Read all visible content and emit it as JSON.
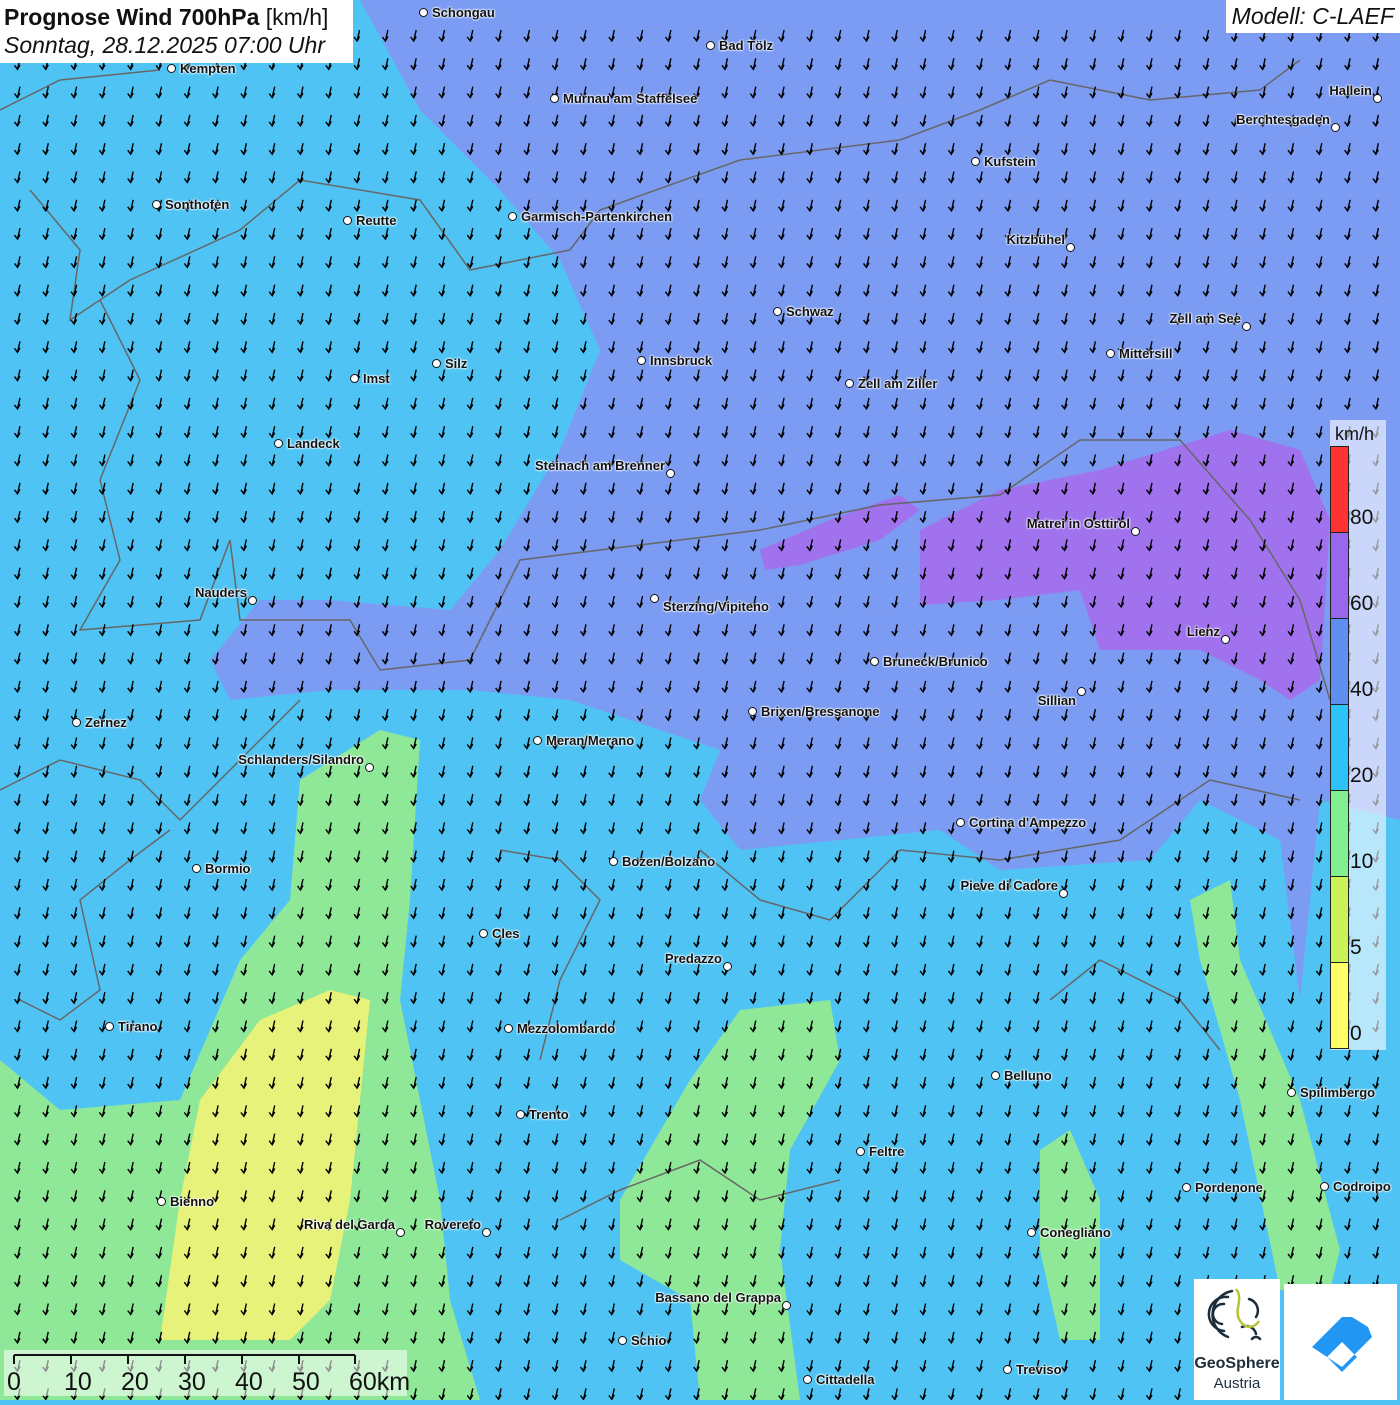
{
  "header": {
    "title": "Prognose Wind 700hPa",
    "unit": "[km/h]",
    "datetime": "Sonntag, 28.12.2025 07:00 Uhr",
    "model": "Modell: C-LAEF"
  },
  "legend": {
    "unit": "km/h",
    "labels": [
      "80",
      "60",
      "40",
      "20",
      "10",
      "5",
      "0"
    ],
    "colors": [
      "#ff3333",
      "#9966ee",
      "#5f8ff0",
      "#2cc4f8",
      "#80f090",
      "#ccf25a",
      "#ffff66"
    ]
  },
  "scale": {
    "labels": [
      "0",
      "10",
      "20",
      "30",
      "40",
      "50",
      "60km"
    ]
  },
  "logos": {
    "geosphere": "GeoSphere",
    "austria": "Austria"
  },
  "map": {
    "wind_direction": "from north-northeast",
    "colors": {
      "base": "#4fc4f4",
      "strong": "#7b9cf2",
      "very_strong": "#a072ee",
      "light": "#8fe897",
      "calm": "#f0f27a"
    }
  },
  "cities": [
    "Schongau",
    "Bad Tölz",
    "Kempten",
    "Murnau am Staffelsee",
    "Hallein",
    "Berchtesgaden",
    "Kufstein",
    "Sonthofen",
    "Reutte",
    "Garmisch-Partenkirchen",
    "Kitzbühel",
    "Schwaz",
    "Zell am See",
    "Mittersill",
    "Innsbruck",
    "Silz",
    "Imst",
    "Zell am Ziller",
    "Landeck",
    "Steinach am Brenner",
    "Matrei in Osttirol",
    "Nauders",
    "Sterzing/Vipiteno",
    "Lienz",
    "Bruneck/Brunico",
    "Sillian",
    "Brixen/Bressanone",
    "Zernez",
    "Meran/Merano",
    "Schlanders/Silandro",
    "Cortina d'Ampezzo",
    "Bozen/Bolzano",
    "Bormio",
    "Pieve di Cadore",
    "Cles",
    "Predazzo",
    "Tirano",
    "Mezzolombardo",
    "Belluno",
    "Spilimbergo",
    "Trento",
    "Feltre",
    "Pordenone",
    "Codroipo",
    "Bienno",
    "Riva del Garda",
    "Rovereto",
    "Conegliano",
    "Bassano del Grappa",
    "Schio",
    "Treviso",
    "Cittadella"
  ]
}
